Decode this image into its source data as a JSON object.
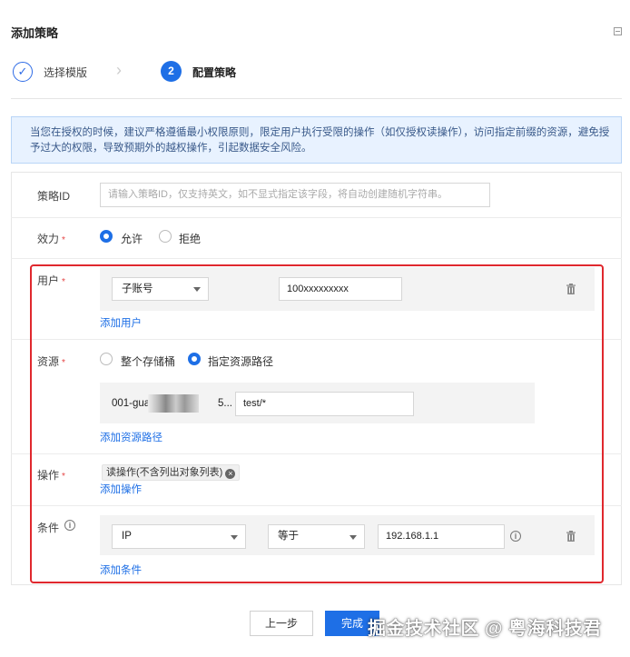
{
  "dialog": {
    "title": "添加策略"
  },
  "steps": [
    {
      "label": "选择模版",
      "status": "done"
    },
    {
      "number": "2",
      "label": "配置策略",
      "status": "active"
    }
  ],
  "notice": "当您在授权的时候，建议严格遵循最小权限原则，限定用户执行受限的操作（如仅授权读操作），访问指定前缀的资源，避免授予过大的权限，导致预期外的越权操作，引起数据安全风险。",
  "form": {
    "policy_id": {
      "label": "策略ID",
      "placeholder": "请输入策略ID，仅支持英文，如不显式指定该字段，将自动创建随机字符串。"
    },
    "effect": {
      "label": "效力",
      "options": [
        "允许",
        "拒绝"
      ],
      "selected": "允许"
    },
    "user": {
      "label": "用户",
      "type_select": "子账号",
      "value": "100xxxxxxxxx",
      "add_link": "添加用户"
    },
    "resource": {
      "label": "资源",
      "options": [
        "整个存储桶",
        "指定资源路径"
      ],
      "selected": "指定资源路径",
      "bucket_prefix": "001-gua",
      "bucket_suffix": "5...",
      "path_value": "test/*",
      "add_link": "添加资源路径"
    },
    "action": {
      "label": "操作",
      "tags": [
        "读操作(不含列出对象列表)"
      ],
      "add_link": "添加操作"
    },
    "condition": {
      "label": "条件",
      "key": "IP",
      "operator": "等于",
      "value": "192.168.1.1",
      "add_link": "添加条件"
    },
    "required_mark": "*"
  },
  "buttons": {
    "prev": "上一步",
    "done": "完成"
  },
  "watermark": "掘金技术社区 @ 粤海科技君",
  "colors": {
    "primary": "#1e6fe6",
    "highlight_frame": "#e0282e",
    "notice_bg": "#e8f2ff"
  }
}
